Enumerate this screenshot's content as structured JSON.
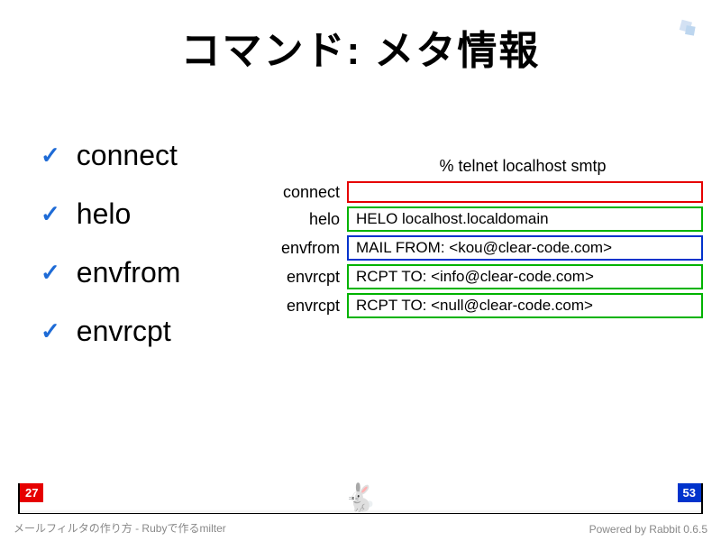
{
  "title": "コマンド: メタ情報",
  "bullets": {
    "b0": "connect",
    "b1": "helo",
    "b2": "envfrom",
    "b3": "envrcpt"
  },
  "diagram": {
    "header": "% telnet localhost smtp",
    "rows": {
      "r0": {
        "label": "connect",
        "value": ""
      },
      "r1": {
        "label": "helo",
        "value": "HELO localhost.localdomain"
      },
      "r2": {
        "label": "envfrom",
        "value": "MAIL FROM: <kou@clear-code.com>"
      },
      "r3": {
        "label": "envrcpt",
        "value": "RCPT TO: <info@clear-code.com>"
      },
      "r4": {
        "label": "envrcpt",
        "value": "RCPT TO: <null@clear-code.com>"
      }
    }
  },
  "footer": {
    "left": "メールフィルタの作り方 - Rubyで作るmilter",
    "right": "Powered by Rabbit 0.6.5",
    "current_page": "27",
    "total_pages": "53"
  }
}
